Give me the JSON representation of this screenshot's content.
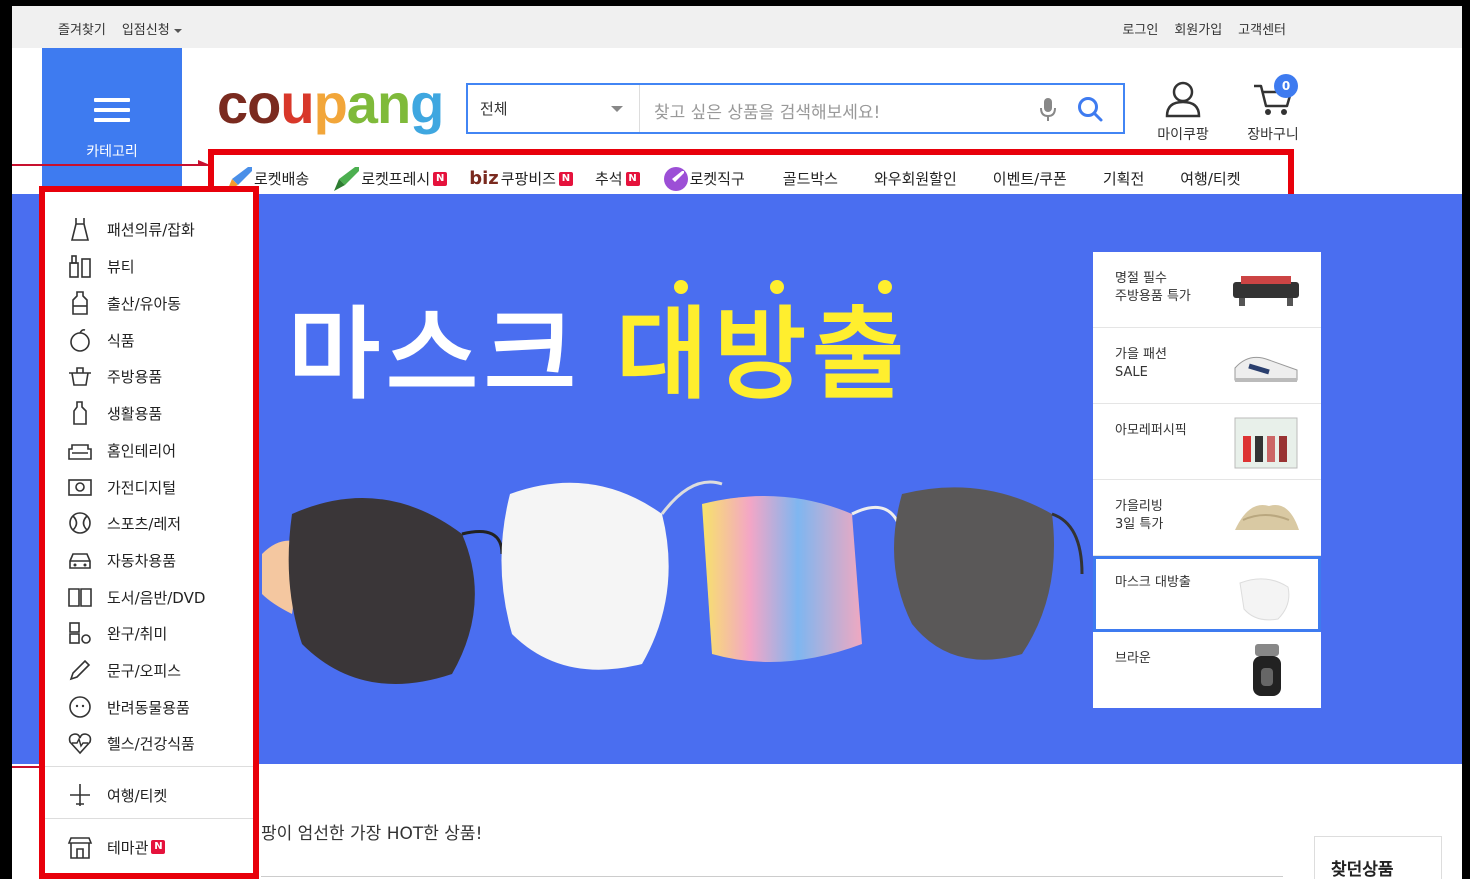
{
  "topbar": {
    "bookmark": "즐겨찾기",
    "seller": "입점신청",
    "login": "로그인",
    "signup": "회원가입",
    "customer_center": "고객센터"
  },
  "category_button": {
    "label": "카테고리",
    "icon": "hamburger-icon"
  },
  "logo": {
    "parts": [
      "co",
      "u",
      "p",
      "an",
      "g"
    ],
    "colors": [
      "#7a2a1f",
      "#d8382a",
      "#f2a63a",
      "#7fba3a",
      "#3fa7e0"
    ]
  },
  "search": {
    "category_value": "전체",
    "placeholder": "찾고 싶은 상품을 검색해보세요!"
  },
  "user": {
    "my_label": "마이쿠팡",
    "cart_label": "장바구니",
    "cart_count": "0"
  },
  "nav": {
    "items": [
      {
        "label": "로켓배송",
        "icon": "rocket-icon",
        "new": false
      },
      {
        "label": "로켓프레시",
        "icon": "rocket-green-icon",
        "new": true
      },
      {
        "label": "쿠팡비즈",
        "prefix": "biz",
        "new": true
      },
      {
        "label": "추석",
        "new": true
      },
      {
        "label": "로켓직구",
        "icon": "rocket-global-icon",
        "new": false
      },
      {
        "label": "골드박스",
        "new": false
      },
      {
        "label": "와우회원할인",
        "new": false
      },
      {
        "label": "이벤트/쿠폰",
        "new": false
      },
      {
        "label": "기획전",
        "new": false
      },
      {
        "label": "여행/티켓",
        "new": false
      }
    ],
    "new_badge": "N"
  },
  "banner": {
    "title_white": "마스크",
    "title_yellow": "대방출",
    "bg_color": "#4a6ef0"
  },
  "promo_list": [
    {
      "line1": "명절 필수",
      "line2": "주방용품 특가",
      "thumb": "grill-icon"
    },
    {
      "line1": "가을 패션",
      "line2": "SALE",
      "thumb": "sneaker-icon"
    },
    {
      "line1": "아모레퍼시픽",
      "line2": "",
      "thumb": "cosmetics-icon"
    },
    {
      "line1": "가을리빙",
      "line2": "3일 특가",
      "thumb": "towel-icon"
    },
    {
      "line1": "마스크 대방출",
      "line2": "",
      "thumb": "mask-icon",
      "active": true
    },
    {
      "line1": "브라운",
      "line2": "",
      "thumb": "shaver-icon"
    }
  ],
  "sidebar": {
    "items": [
      {
        "label": "패션의류/잡화",
        "icon": "dress-icon"
      },
      {
        "label": "뷰티",
        "icon": "cosmetic-bottle-icon"
      },
      {
        "label": "출산/유아동",
        "icon": "baby-bottle-icon"
      },
      {
        "label": "식품",
        "icon": "apple-icon"
      },
      {
        "label": "주방용품",
        "icon": "pot-icon"
      },
      {
        "label": "생활용품",
        "icon": "detergent-icon"
      },
      {
        "label": "홈인테리어",
        "icon": "sofa-icon"
      },
      {
        "label": "가전디지털",
        "icon": "camera-icon"
      },
      {
        "label": "스포츠/레저",
        "icon": "ball-icon"
      },
      {
        "label": "자동차용품",
        "icon": "car-icon"
      },
      {
        "label": "도서/음반/DVD",
        "icon": "book-icon"
      },
      {
        "label": "완구/취미",
        "icon": "toy-icon"
      },
      {
        "label": "문구/오피스",
        "icon": "pencil-icon"
      },
      {
        "label": "반려동물용품",
        "icon": "dog-icon"
      },
      {
        "label": "헬스/건강식품",
        "icon": "heart-pulse-icon"
      }
    ],
    "travel": {
      "label": "여행/티켓",
      "icon": "airplane-icon"
    },
    "theme": {
      "label": "테마관",
      "icon": "store-icon",
      "new": true
    }
  },
  "section": {
    "hot_products": "팡이 엄선한 가장 HOT한 상품!",
    "recent": "찾던상품"
  }
}
